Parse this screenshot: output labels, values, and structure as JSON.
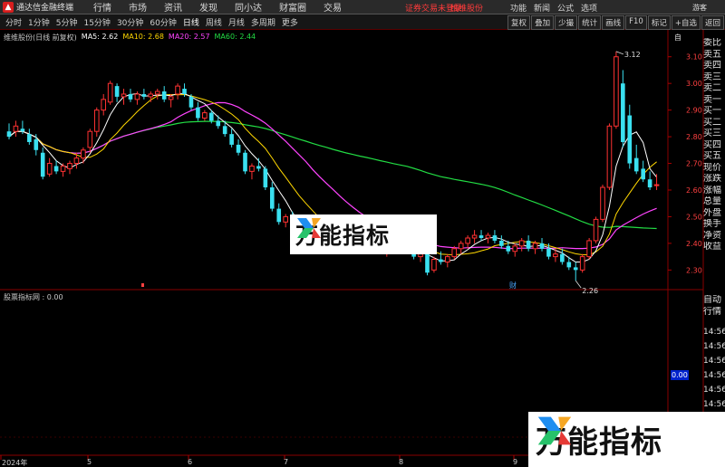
{
  "titlebar": {
    "app_title": "通达信金融终端",
    "menu": [
      "行情",
      "市场",
      "资讯",
      "发现",
      "同小达",
      "财富圈",
      "交易"
    ],
    "login_status": "证券交易未登录",
    "stock_link": "维维股份",
    "right_menu": [
      "功能",
      "新闻",
      "公式",
      "选项"
    ],
    "guest": "游客"
  },
  "toolbar": {
    "periods": [
      "分时",
      "1分钟",
      "5分钟",
      "15分钟",
      "30分钟",
      "60分钟",
      "日线",
      "周线",
      "月线",
      "多周期",
      "更多"
    ],
    "active_period": "日线",
    "tools": [
      "复权",
      "叠加",
      "少撮",
      "统计",
      "画线",
      "F10",
      "标记",
      "+自选",
      "返回"
    ]
  },
  "chart": {
    "legend": {
      "name": "维维股份(日线 前复权)",
      "ma5": "MA5: 2.62",
      "ma10": "MA10: 2.68",
      "ma20": "MA20: 2.57",
      "ma60": "MA60: 2.44"
    },
    "colors": {
      "up": "#ff3232",
      "down": "#3ae0f0",
      "ma5": "#ffffff",
      "ma10": "#ffd700",
      "ma20": "#ff44ff",
      "ma60": "#22dd44"
    },
    "high_marker": "3.12",
    "low_marker": "2.26",
    "fin_marker": "财",
    "y_ticks": [
      "3.10",
      "3.00",
      "2.90",
      "2.80",
      "2.70",
      "2.60",
      "2.50",
      "2.40",
      "2.30"
    ],
    "indicator_legend": "股票指标网 : 0.00",
    "indicator_value": "0.00",
    "auto_flag": "自",
    "dates": [
      "2024年",
      "5",
      "6",
      "7",
      "8",
      "9"
    ]
  },
  "side_panel": {
    "quote_rows": [
      "委比",
      "卖五",
      "卖四",
      "卖三",
      "卖二",
      "卖一",
      "买一",
      "买二",
      "买三",
      "买四",
      "买五",
      "现价",
      "涨跌",
      "涨幅",
      "总量",
      "外盘",
      "换手",
      "净资",
      "收益"
    ],
    "section2": [
      "自动",
      "行情"
    ],
    "times": [
      "14:56",
      "14:56",
      "14:56",
      "14:56",
      "14:56",
      "14:56",
      "14:56",
      "14:56",
      "14:56",
      "14:56"
    ]
  },
  "watermark": {
    "text": "万能指标"
  },
  "candles": [
    {
      "o": 2.82,
      "h": 2.85,
      "l": 2.79,
      "c": 2.8
    },
    {
      "o": 2.82,
      "h": 2.86,
      "l": 2.8,
      "c": 2.84
    },
    {
      "o": 2.83,
      "h": 2.86,
      "l": 2.81,
      "c": 2.82
    },
    {
      "o": 2.81,
      "h": 2.83,
      "l": 2.77,
      "c": 2.78
    },
    {
      "o": 2.79,
      "h": 2.81,
      "l": 2.73,
      "c": 2.75
    },
    {
      "o": 2.74,
      "h": 2.76,
      "l": 2.64,
      "c": 2.65
    },
    {
      "o": 2.66,
      "h": 2.72,
      "l": 2.65,
      "c": 2.7
    },
    {
      "o": 2.69,
      "h": 2.71,
      "l": 2.66,
      "c": 2.67
    },
    {
      "o": 2.67,
      "h": 2.7,
      "l": 2.65,
      "c": 2.69
    },
    {
      "o": 2.68,
      "h": 2.71,
      "l": 2.66,
      "c": 2.7
    },
    {
      "o": 2.7,
      "h": 2.74,
      "l": 2.68,
      "c": 2.72
    },
    {
      "o": 2.72,
      "h": 2.76,
      "l": 2.7,
      "c": 2.75
    },
    {
      "o": 2.76,
      "h": 2.83,
      "l": 2.74,
      "c": 2.82
    },
    {
      "o": 2.82,
      "h": 2.91,
      "l": 2.8,
      "c": 2.9
    },
    {
      "o": 2.9,
      "h": 2.96,
      "l": 2.88,
      "c": 2.94
    },
    {
      "o": 2.93,
      "h": 3.01,
      "l": 2.92,
      "c": 3.0
    },
    {
      "o": 2.99,
      "h": 3.0,
      "l": 2.93,
      "c": 2.95
    },
    {
      "o": 2.95,
      "h": 2.98,
      "l": 2.92,
      "c": 2.96
    },
    {
      "o": 2.96,
      "h": 2.98,
      "l": 2.93,
      "c": 2.94
    },
    {
      "o": 2.94,
      "h": 2.97,
      "l": 2.92,
      "c": 2.96
    },
    {
      "o": 2.96,
      "h": 2.98,
      "l": 2.94,
      "c": 2.95
    },
    {
      "o": 2.95,
      "h": 2.97,
      "l": 2.93,
      "c": 2.96
    },
    {
      "o": 2.96,
      "h": 2.98,
      "l": 2.94,
      "c": 2.97
    },
    {
      "o": 2.97,
      "h": 2.99,
      "l": 2.93,
      "c": 2.94
    },
    {
      "o": 2.94,
      "h": 2.96,
      "l": 2.91,
      "c": 2.95
    },
    {
      "o": 2.96,
      "h": 3.0,
      "l": 2.94,
      "c": 2.99
    },
    {
      "o": 2.98,
      "h": 3.0,
      "l": 2.95,
      "c": 2.96
    },
    {
      "o": 2.95,
      "h": 2.96,
      "l": 2.9,
      "c": 2.91
    },
    {
      "o": 2.91,
      "h": 2.93,
      "l": 2.86,
      "c": 2.87
    },
    {
      "o": 2.87,
      "h": 2.9,
      "l": 2.86,
      "c": 2.89
    },
    {
      "o": 2.89,
      "h": 2.9,
      "l": 2.85,
      "c": 2.86
    },
    {
      "o": 2.86,
      "h": 2.88,
      "l": 2.83,
      "c": 2.84
    },
    {
      "o": 2.84,
      "h": 2.86,
      "l": 2.8,
      "c": 2.81
    },
    {
      "o": 2.81,
      "h": 2.83,
      "l": 2.76,
      "c": 2.77
    },
    {
      "o": 2.77,
      "h": 2.79,
      "l": 2.73,
      "c": 2.74
    },
    {
      "o": 2.74,
      "h": 2.75,
      "l": 2.66,
      "c": 2.67
    },
    {
      "o": 2.67,
      "h": 2.7,
      "l": 2.64,
      "c": 2.69
    },
    {
      "o": 2.69,
      "h": 2.72,
      "l": 2.67,
      "c": 2.68
    },
    {
      "o": 2.68,
      "h": 2.69,
      "l": 2.6,
      "c": 2.61
    },
    {
      "o": 2.61,
      "h": 2.63,
      "l": 2.52,
      "c": 2.53
    },
    {
      "o": 2.53,
      "h": 2.55,
      "l": 2.47,
      "c": 2.48
    },
    {
      "o": 2.48,
      "h": 2.51,
      "l": 2.46,
      "c": 2.5
    },
    {
      "o": 2.5,
      "h": 2.52,
      "l": 2.45,
      "c": 2.46
    },
    {
      "o": 2.46,
      "h": 2.48,
      "l": 2.42,
      "c": 2.43
    },
    {
      "o": 2.43,
      "h": 2.46,
      "l": 2.41,
      "c": 2.45
    },
    {
      "o": 2.45,
      "h": 2.47,
      "l": 2.39,
      "c": 2.4
    },
    {
      "o": 2.4,
      "h": 2.43,
      "l": 2.37,
      "c": 2.42
    },
    {
      "o": 2.42,
      "h": 2.45,
      "l": 2.4,
      "c": 2.43
    },
    {
      "o": 2.43,
      "h": 2.46,
      "l": 2.38,
      "c": 2.39
    },
    {
      "o": 2.39,
      "h": 2.42,
      "l": 2.37,
      "c": 2.41
    },
    {
      "o": 2.41,
      "h": 2.44,
      "l": 2.39,
      "c": 2.4
    },
    {
      "o": 2.4,
      "h": 2.44,
      "l": 2.38,
      "c": 2.43
    },
    {
      "o": 2.43,
      "h": 2.46,
      "l": 2.41,
      "c": 2.42
    },
    {
      "o": 2.42,
      "h": 2.45,
      "l": 2.4,
      "c": 2.44
    },
    {
      "o": 2.44,
      "h": 2.46,
      "l": 2.41,
      "c": 2.42
    },
    {
      "o": 2.42,
      "h": 2.43,
      "l": 2.36,
      "c": 2.37
    },
    {
      "o": 2.37,
      "h": 2.4,
      "l": 2.35,
      "c": 2.39
    },
    {
      "o": 2.39,
      "h": 2.41,
      "l": 2.36,
      "c": 2.38
    },
    {
      "o": 2.38,
      "h": 2.41,
      "l": 2.36,
      "c": 2.4
    },
    {
      "o": 2.4,
      "h": 2.42,
      "l": 2.38,
      "c": 2.39
    },
    {
      "o": 2.39,
      "h": 2.4,
      "l": 2.34,
      "c": 2.35
    },
    {
      "o": 2.35,
      "h": 2.38,
      "l": 2.33,
      "c": 2.36
    },
    {
      "o": 2.36,
      "h": 2.38,
      "l": 2.28,
      "c": 2.29
    },
    {
      "o": 2.3,
      "h": 2.35,
      "l": 2.29,
      "c": 2.34
    },
    {
      "o": 2.34,
      "h": 2.37,
      "l": 2.32,
      "c": 2.33
    },
    {
      "o": 2.33,
      "h": 2.36,
      "l": 2.31,
      "c": 2.35
    },
    {
      "o": 2.35,
      "h": 2.39,
      "l": 2.34,
      "c": 2.38
    },
    {
      "o": 2.38,
      "h": 2.41,
      "l": 2.36,
      "c": 2.4
    },
    {
      "o": 2.4,
      "h": 2.43,
      "l": 2.38,
      "c": 2.42
    },
    {
      "o": 2.42,
      "h": 2.45,
      "l": 2.4,
      "c": 2.43
    },
    {
      "o": 2.43,
      "h": 2.45,
      "l": 2.41,
      "c": 2.42
    },
    {
      "o": 2.42,
      "h": 2.44,
      "l": 2.4,
      "c": 2.43
    },
    {
      "o": 2.43,
      "h": 2.45,
      "l": 2.4,
      "c": 2.41
    },
    {
      "o": 2.41,
      "h": 2.43,
      "l": 2.38,
      "c": 2.39
    },
    {
      "o": 2.39,
      "h": 2.41,
      "l": 2.36,
      "c": 2.37
    },
    {
      "o": 2.37,
      "h": 2.4,
      "l": 2.35,
      "c": 2.39
    },
    {
      "o": 2.39,
      "h": 2.42,
      "l": 2.37,
      "c": 2.41
    },
    {
      "o": 2.41,
      "h": 2.43,
      "l": 2.37,
      "c": 2.38
    },
    {
      "o": 2.38,
      "h": 2.41,
      "l": 2.36,
      "c": 2.4
    },
    {
      "o": 2.4,
      "h": 2.42,
      "l": 2.37,
      "c": 2.38
    },
    {
      "o": 2.38,
      "h": 2.4,
      "l": 2.34,
      "c": 2.35
    },
    {
      "o": 2.35,
      "h": 2.38,
      "l": 2.33,
      "c": 2.36
    },
    {
      "o": 2.36,
      "h": 2.38,
      "l": 2.32,
      "c": 2.33
    },
    {
      "o": 2.33,
      "h": 2.35,
      "l": 2.3,
      "c": 2.31
    },
    {
      "o": 2.31,
      "h": 2.33,
      "l": 2.26,
      "c": 2.3
    },
    {
      "o": 2.3,
      "h": 2.36,
      "l": 2.29,
      "c": 2.35
    },
    {
      "o": 2.35,
      "h": 2.42,
      "l": 2.34,
      "c": 2.41
    },
    {
      "o": 2.41,
      "h": 2.5,
      "l": 2.4,
      "c": 2.49
    },
    {
      "o": 2.49,
      "h": 2.62,
      "l": 2.48,
      "c": 2.61
    },
    {
      "o": 2.61,
      "h": 2.85,
      "l": 2.6,
      "c": 2.84
    },
    {
      "o": 2.84,
      "h": 3.12,
      "l": 2.83,
      "c": 3.1
    },
    {
      "o": 3.0,
      "h": 3.05,
      "l": 2.76,
      "c": 2.78
    },
    {
      "o": 2.88,
      "h": 2.92,
      "l": 2.68,
      "c": 2.7
    },
    {
      "o": 2.72,
      "h": 2.77,
      "l": 2.66,
      "c": 2.67
    },
    {
      "o": 2.68,
      "h": 2.71,
      "l": 2.63,
      "c": 2.64
    },
    {
      "o": 2.64,
      "h": 2.67,
      "l": 2.6,
      "c": 2.61
    },
    {
      "o": 2.62,
      "h": 2.66,
      "l": 2.6,
      "c": 2.62
    }
  ]
}
